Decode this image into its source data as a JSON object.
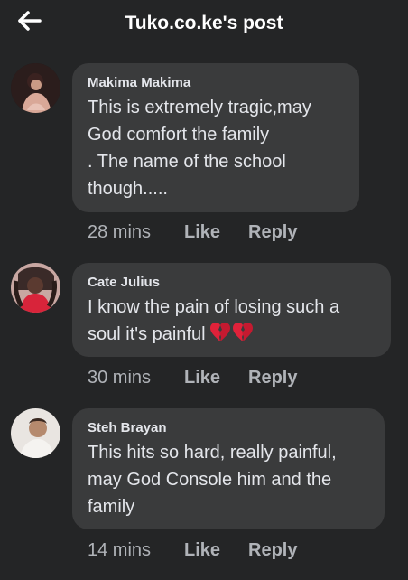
{
  "header": {
    "title": "Tuko.co.ke's post",
    "back_icon": "arrow-left-icon"
  },
  "colors": {
    "background": "#242526",
    "bubble": "#3a3b3c",
    "text_primary": "#e4e6eb",
    "text_secondary": "#b0b3b8"
  },
  "comments": [
    {
      "author": "Makima Makima",
      "text": "This is extremely tragic,may\nGod comfort the family\n. The name of the school\nthough.....",
      "time": "28 mins",
      "like": "Like",
      "reply": "Reply"
    },
    {
      "author": "Cate Julius",
      "text": "I know the pain of losing such a\nsoul it's painful",
      "emoji": "broken-heart-icon",
      "time": "30 mins",
      "like": "Like",
      "reply": "Reply"
    },
    {
      "author": "Steh Brayan",
      "text": "This hits so hard, really painful,\nmay God Console him and the\nfamily",
      "time": "14 mins",
      "like": "Like",
      "reply": "Reply"
    }
  ]
}
